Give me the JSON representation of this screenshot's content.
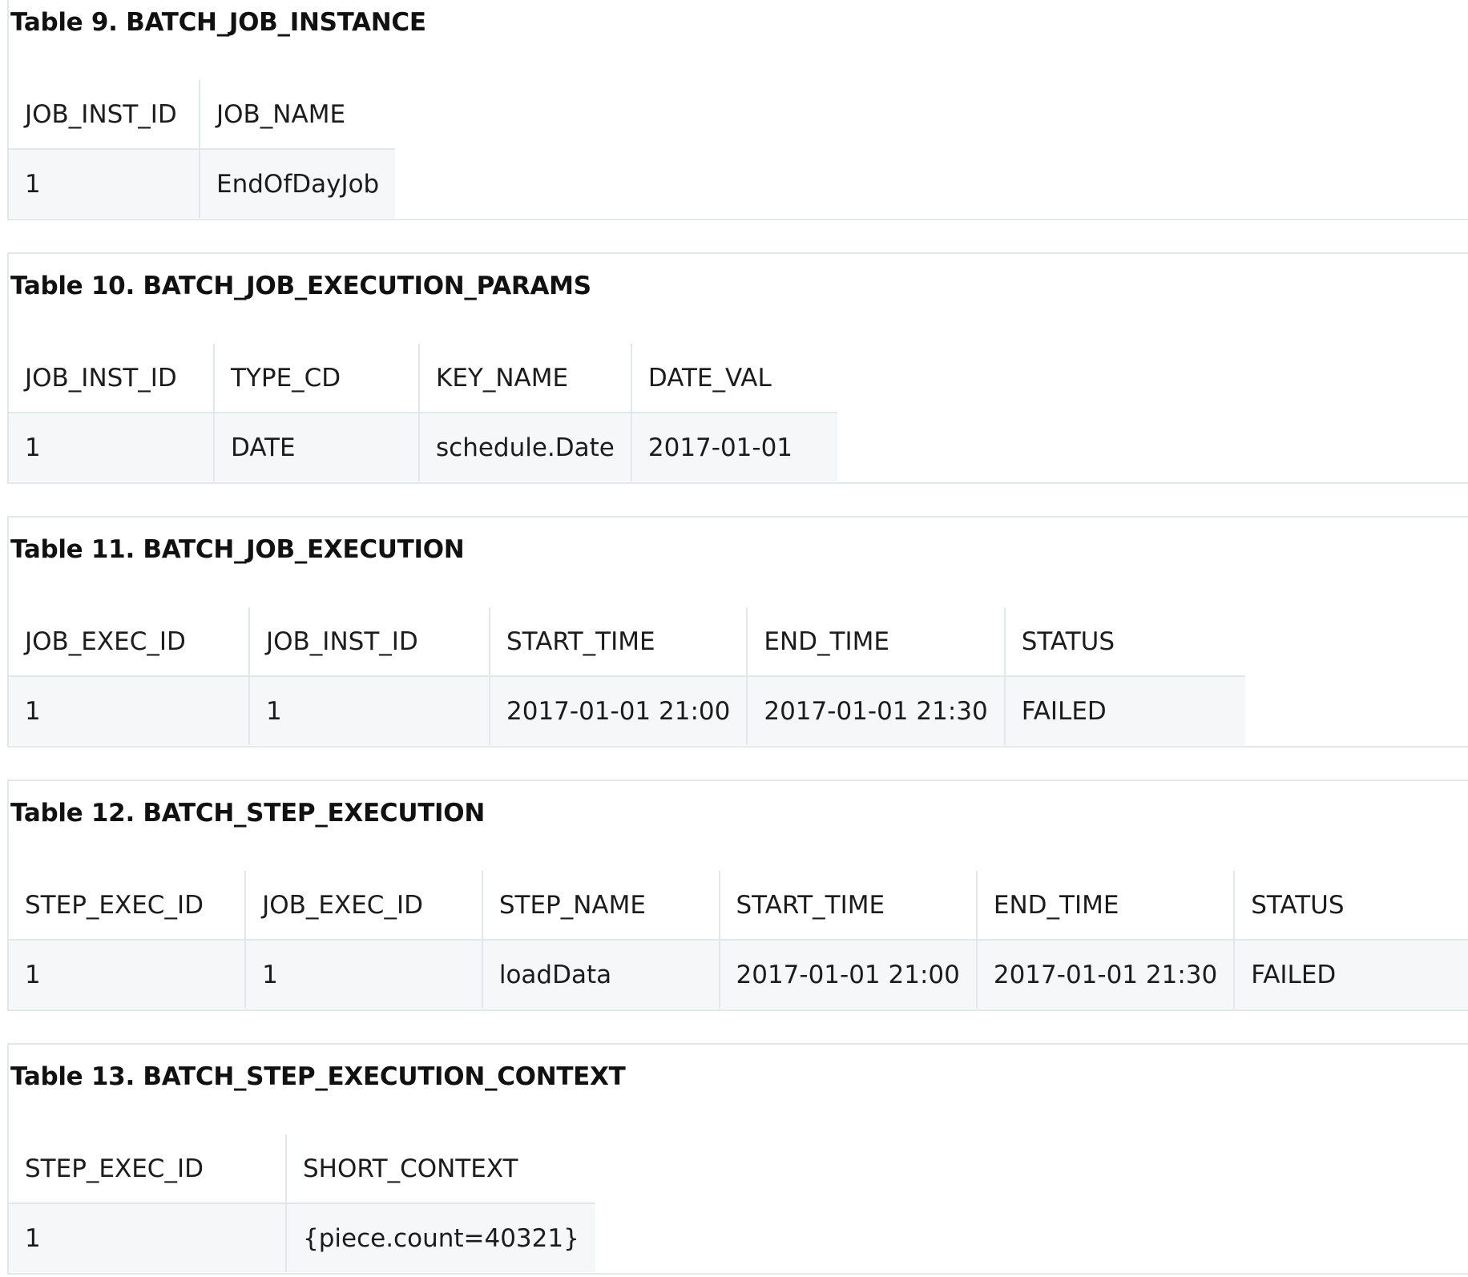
{
  "tables": [
    {
      "caption": "Table 9. BATCH_JOB_INSTANCE",
      "columns": [
        "JOB_INST_ID",
        "JOB_NAME"
      ],
      "rows": [
        [
          "1",
          "EndOfDayJob"
        ]
      ]
    },
    {
      "caption": "Table 10. BATCH_JOB_EXECUTION_PARAMS",
      "columns": [
        "JOB_INST_ID",
        "TYPE_CD",
        "KEY_NAME",
        "DATE_VAL"
      ],
      "rows": [
        [
          "1",
          "DATE",
          "schedule.Date",
          "2017-01-01"
        ]
      ]
    },
    {
      "caption": "Table 11. BATCH_JOB_EXECUTION",
      "columns": [
        "JOB_EXEC_ID",
        "JOB_INST_ID",
        "START_TIME",
        "END_TIME",
        "STATUS"
      ],
      "rows": [
        [
          "1",
          "1",
          "2017-01-01 21:00",
          "2017-01-01 21:30",
          "FAILED"
        ]
      ]
    },
    {
      "caption": "Table 12. BATCH_STEP_EXECUTION",
      "columns": [
        "STEP_EXEC_ID",
        "JOB_EXEC_ID",
        "STEP_NAME",
        "START_TIME",
        "END_TIME",
        "STATUS"
      ],
      "rows": [
        [
          "1",
          "1",
          "loadData",
          "2017-01-01 21:00",
          "2017-01-01 21:30",
          "FAILED"
        ]
      ]
    },
    {
      "caption": "Table 13. BATCH_STEP_EXECUTION_CONTEXT",
      "columns": [
        "STEP_EXEC_ID",
        "SHORT_CONTEXT"
      ],
      "rows": [
        [
          "1",
          "{piece.count=40321}"
        ]
      ]
    }
  ]
}
